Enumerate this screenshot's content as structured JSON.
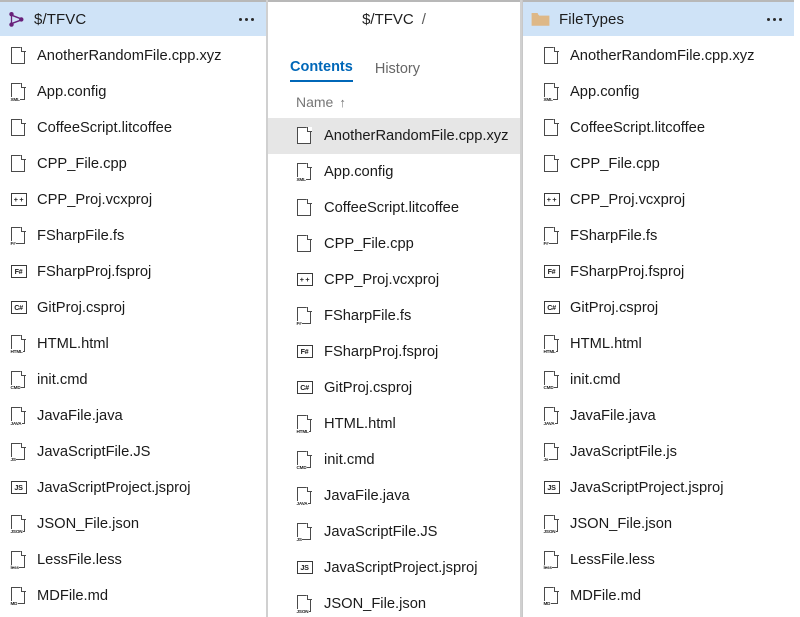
{
  "panels": {
    "left": {
      "header": {
        "icon": "tfvc-icon",
        "title": "$/TFVC",
        "menu_icon": "ellipsis-icon",
        "bg_color": "#cfe3f7",
        "icon_color": "#68217a"
      },
      "files": [
        {
          "name": "AnotherRandomFile.cpp.xyz",
          "icon": "file-blank-icon",
          "tag": ""
        },
        {
          "name": "App.config",
          "icon": "file-xml-icon",
          "tag": "XML"
        },
        {
          "name": "CoffeeScript.litcoffee",
          "icon": "file-coffee-icon",
          "tag": ""
        },
        {
          "name": "CPP_File.cpp",
          "icon": "file-cpp-icon",
          "tag": ""
        },
        {
          "name": "CPP_Proj.vcxproj",
          "icon": "project-cpp-icon",
          "tag": "+ +",
          "boxed": true
        },
        {
          "name": "FSharpFile.fs",
          "icon": "file-fsharp-icon",
          "tag": "F#"
        },
        {
          "name": "FSharpProj.fsproj",
          "icon": "project-fsharp-icon",
          "tag": "F#",
          "boxed": true
        },
        {
          "name": "GitProj.csproj",
          "icon": "project-csharp-icon",
          "tag": "C#",
          "boxed": true
        },
        {
          "name": "HTML.html",
          "icon": "file-html-icon",
          "tag": "HTML"
        },
        {
          "name": "init.cmd",
          "icon": "file-cmd-icon",
          "tag": "CMD"
        },
        {
          "name": "JavaFile.java",
          "icon": "file-java-icon",
          "tag": "JAVA"
        },
        {
          "name": "JavaScriptFile.JS",
          "icon": "file-js-icon",
          "tag": "JS"
        },
        {
          "name": "JavaScriptProject.jsproj",
          "icon": "project-js-icon",
          "tag": "JS",
          "boxed": true
        },
        {
          "name": "JSON_File.json",
          "icon": "file-json-icon",
          "tag": "JSON"
        },
        {
          "name": "LessFile.less",
          "icon": "file-less-icon",
          "tag": "less"
        },
        {
          "name": "MDFile.md",
          "icon": "file-md-icon",
          "tag": "MD"
        }
      ]
    },
    "middle": {
      "breadcrumb": {
        "root": "$/TFVC",
        "separator": "/"
      },
      "tabs": [
        {
          "label": "Contents",
          "active": true
        },
        {
          "label": "History",
          "active": false
        }
      ],
      "column_header": {
        "label": "Name",
        "sort_arrow": "↑"
      },
      "selected_file": "AnotherRandomFile.cpp.xyz",
      "files": [
        {
          "name": "AnotherRandomFile.cpp.xyz",
          "icon": "file-blank-icon",
          "tag": "",
          "selected": true
        },
        {
          "name": "App.config",
          "icon": "file-xml-icon",
          "tag": "XML"
        },
        {
          "name": "CoffeeScript.litcoffee",
          "icon": "file-coffee-icon",
          "tag": ""
        },
        {
          "name": "CPP_File.cpp",
          "icon": "file-cpp-icon",
          "tag": ""
        },
        {
          "name": "CPP_Proj.vcxproj",
          "icon": "project-cpp-icon",
          "tag": "+ +",
          "boxed": true
        },
        {
          "name": "FSharpFile.fs",
          "icon": "file-fsharp-icon",
          "tag": "F#"
        },
        {
          "name": "FSharpProj.fsproj",
          "icon": "project-fsharp-icon",
          "tag": "F#",
          "boxed": true
        },
        {
          "name": "GitProj.csproj",
          "icon": "project-csharp-icon",
          "tag": "C#",
          "boxed": true
        },
        {
          "name": "HTML.html",
          "icon": "file-html-icon",
          "tag": "HTML"
        },
        {
          "name": "init.cmd",
          "icon": "file-cmd-icon",
          "tag": "CMD"
        },
        {
          "name": "JavaFile.java",
          "icon": "file-java-icon",
          "tag": "JAVA"
        },
        {
          "name": "JavaScriptFile.JS",
          "icon": "file-js-icon",
          "tag": "JS"
        },
        {
          "name": "JavaScriptProject.jsproj",
          "icon": "project-js-icon",
          "tag": "JS",
          "boxed": true
        },
        {
          "name": "JSON_File.json",
          "icon": "file-json-icon",
          "tag": "JSON"
        }
      ]
    },
    "right": {
      "header": {
        "icon": "folder-icon",
        "title": "FileTypes",
        "menu_icon": "ellipsis-icon",
        "bg_color": "#cfe3f7",
        "icon_color": "#deb887"
      },
      "files": [
        {
          "name": "AnotherRandomFile.cpp.xyz",
          "icon": "file-blank-icon",
          "tag": ""
        },
        {
          "name": "App.config",
          "icon": "file-xml-icon",
          "tag": "XML"
        },
        {
          "name": "CoffeeScript.litcoffee",
          "icon": "file-coffee-icon",
          "tag": ""
        },
        {
          "name": "CPP_File.cpp",
          "icon": "file-cpp-icon",
          "tag": ""
        },
        {
          "name": "CPP_Proj.vcxproj",
          "icon": "project-cpp-icon",
          "tag": "+ +",
          "boxed": true
        },
        {
          "name": "FSharpFile.fs",
          "icon": "file-fsharp-icon",
          "tag": "F#"
        },
        {
          "name": "FSharpProj.fsproj",
          "icon": "project-fsharp-icon",
          "tag": "F#",
          "boxed": true
        },
        {
          "name": "GitProj.csproj",
          "icon": "project-csharp-icon",
          "tag": "C#",
          "boxed": true
        },
        {
          "name": "HTML.html",
          "icon": "file-html-icon",
          "tag": "HTML"
        },
        {
          "name": "init.cmd",
          "icon": "file-cmd-icon",
          "tag": "CMD"
        },
        {
          "name": "JavaFile.java",
          "icon": "file-java-icon",
          "tag": "JAVA"
        },
        {
          "name": "JavaScriptFile.js",
          "icon": "file-js-icon",
          "tag": "Js"
        },
        {
          "name": "JavaScriptProject.jsproj",
          "icon": "project-js-icon",
          "tag": "JS",
          "boxed": true
        },
        {
          "name": "JSON_File.json",
          "icon": "file-json-icon",
          "tag": "JSON"
        },
        {
          "name": "LessFile.less",
          "icon": "file-less-icon",
          "tag": "less"
        },
        {
          "name": "MDFile.md",
          "icon": "file-md-icon",
          "tag": "MD"
        }
      ]
    }
  }
}
